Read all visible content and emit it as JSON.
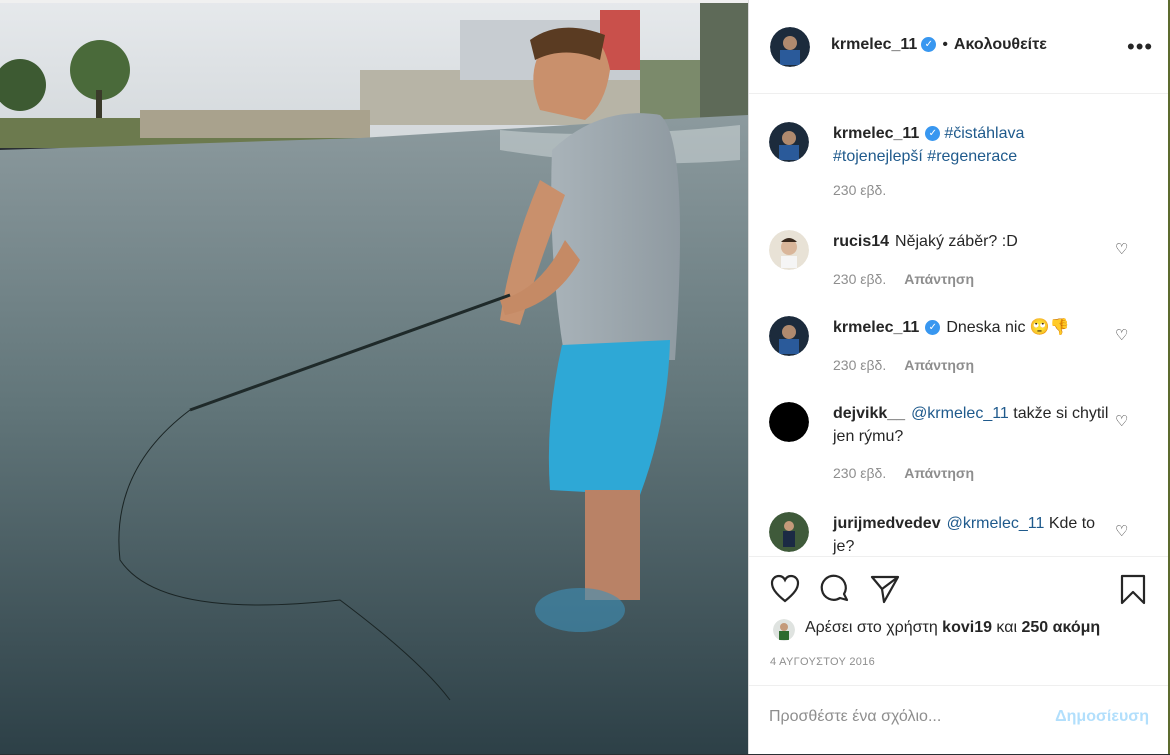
{
  "header": {
    "username": "krmelec_11",
    "separator": "•",
    "follow_label": "Ακολουθείτε",
    "more_label": "•••"
  },
  "caption": {
    "username": "krmelec_11",
    "hashtags": [
      "#čistáhlava",
      "#tojenejlepší",
      "#regenerace"
    ],
    "time": "230 εβδ."
  },
  "comments": [
    {
      "username": "rucis14",
      "text": "Nějaký záběr? :D",
      "time": "230 εβδ.",
      "reply": "Απάντηση"
    },
    {
      "username": "krmelec_11",
      "text": "Dneska nic 🙄👎",
      "time": "230 εβδ.",
      "reply": "Απάντηση"
    },
    {
      "username": "dejvikk__",
      "mention": "@krmelec_11",
      "text": " takže si chytil jen rýmu?",
      "time": "230 εβδ.",
      "reply": "Απάντηση"
    },
    {
      "username": "jurijmedvedev",
      "mention": "@krmelec_11",
      "text": " Kde to je?"
    }
  ],
  "likes": {
    "prefix": "Αρέσει στο χρήστη ",
    "user": "kovi19",
    "middle": " και ",
    "count": "250 ακόμη"
  },
  "date": "4 ΑΥΓΟΥΣΤΟΥ 2016",
  "add_comment": {
    "placeholder": "Προσθέστε ένα σχόλιο...",
    "post_label": "Δημοσίευση"
  },
  "colors": {
    "verified": "#3897f0",
    "link": "#1f5a8c",
    "post_disabled": "#b2dffc"
  }
}
